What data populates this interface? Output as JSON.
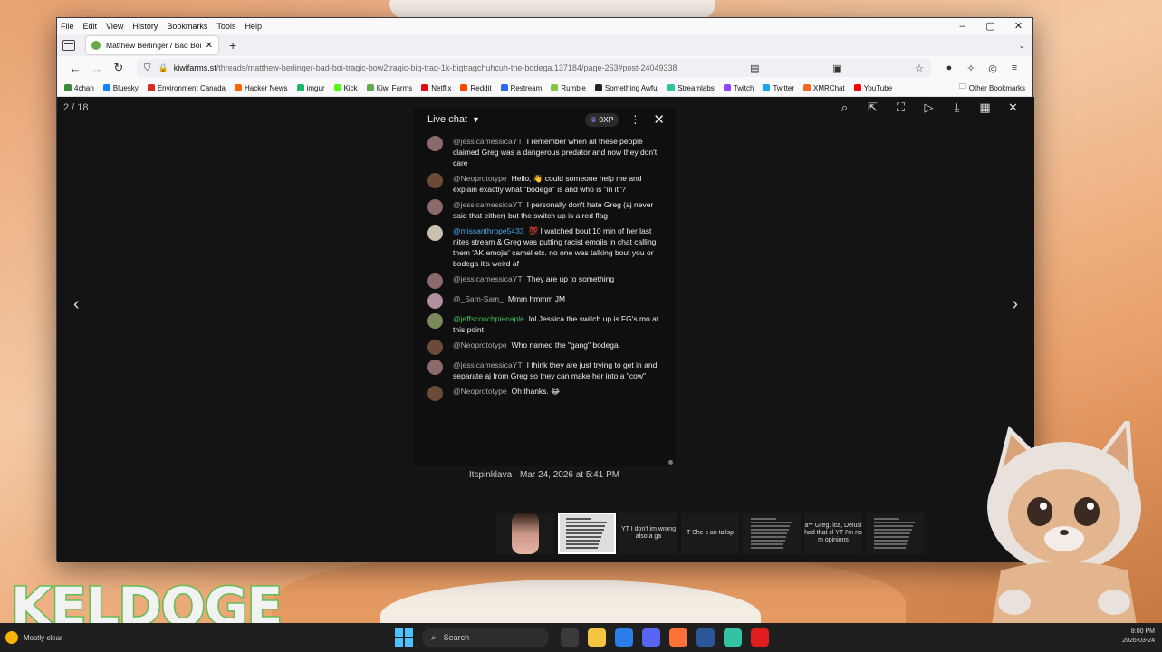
{
  "menubar": {
    "items": [
      "File",
      "Edit",
      "View",
      "History",
      "Bookmarks",
      "Tools",
      "Help"
    ]
  },
  "tab": {
    "title": "Matthew Berlinger / Bad Boi Tr"
  },
  "urlbar": {
    "domain": "kiwifarms.st",
    "path": "/threads/matthew-berlinger-bad-boi-tragic-bow2tragic-big-trag-1k-bigtragchuhcuh-the-bodega.137184/page-253#post-24049338"
  },
  "bookmarks": [
    {
      "label": "4chan",
      "color": "#3a8a3a"
    },
    {
      "label": "Bluesky",
      "color": "#1185fe"
    },
    {
      "label": "Environment Canada",
      "color": "#d52b1e"
    },
    {
      "label": "Hacker News",
      "color": "#ff6600"
    },
    {
      "label": "imgur",
      "color": "#1bb76e"
    },
    {
      "label": "Kick",
      "color": "#53fc18"
    },
    {
      "label": "Kiwi Farms",
      "color": "#66a84a"
    },
    {
      "label": "Netflix",
      "color": "#e50914"
    },
    {
      "label": "Reddit",
      "color": "#ff4500"
    },
    {
      "label": "Restream",
      "color": "#2b6bf3"
    },
    {
      "label": "Rumble",
      "color": "#85c742"
    },
    {
      "label": "Something Awful",
      "color": "#222222"
    },
    {
      "label": "Streamlabs",
      "color": "#31c3a2"
    },
    {
      "label": "Twitch",
      "color": "#9146ff"
    },
    {
      "label": "Twitter",
      "color": "#1da1f2"
    },
    {
      "label": "XMRChat",
      "color": "#f26822"
    },
    {
      "label": "YouTube",
      "color": "#ff0000"
    }
  ],
  "other_bookmarks": "Other Bookmarks",
  "viewer": {
    "counter": "2 / 18",
    "caption": "Itspinklava · Mar 24, 2026 at 5:41 PM"
  },
  "chat": {
    "title": "Live chat",
    "badge": "0XP",
    "messages": [
      {
        "author": "@jessicamessicaYT",
        "text": "I remember when all these people claimed Greg was a dangerous predator and now they don't care",
        "avatar": "#8a6a6a",
        "style": ""
      },
      {
        "author": "@Neoprototype",
        "text": "Hello, 👋 could someone help me and explain exactly what \"bodega\" is and who is \"in it\"?",
        "avatar": "#6b4a3a",
        "style": ""
      },
      {
        "author": "@jessicamessicaYT",
        "text": "I personally don't hate Greg (aj never said that either) but the switch up is a red flag",
        "avatar": "#8a6a6a",
        "style": ""
      },
      {
        "author": "@missanthrope5433",
        "text": "💯 I watched bout 10 min of her last nites stream & Greg was putting racist emojis in chat calling them 'AK emojis' camel etc. no one was talking bout you or bodega it's weird af",
        "avatar": "#c9c0b0",
        "style": "member"
      },
      {
        "author": "@jessicamessicaYT",
        "text": "They are up to something",
        "avatar": "#8a6a6a",
        "style": ""
      },
      {
        "author": "@_Sam-Sam_",
        "text": "Mmm hmmm JM",
        "avatar": "#b08fa0",
        "style": ""
      },
      {
        "author": "@jeffscouchpienaple",
        "text": "lol Jessica the switch up is FG's mo at this point",
        "avatar": "#7a8a5a",
        "style": "green"
      },
      {
        "author": "@Neoprototype",
        "text": "Who named the \"gang\" bodega.",
        "avatar": "#6b4a3a",
        "style": ""
      },
      {
        "author": "@jessicamessicaYT",
        "text": "I think they are just trying to get in and separate aj from Greg so they can make her into a \"cow\"",
        "avatar": "#8a6a6a",
        "style": ""
      },
      {
        "author": "@Neoprototype",
        "text": "Oh thanks. 😂",
        "avatar": "#6b4a3a",
        "style": ""
      }
    ]
  },
  "thumbs": [
    {
      "kind": "face",
      "text": ""
    },
    {
      "kind": "chat",
      "text": ""
    },
    {
      "kind": "text",
      "text": "YT I don't im wrong also a ga"
    },
    {
      "kind": "text",
      "text": "T She c an tailsp"
    },
    {
      "kind": "lines",
      "text": ""
    },
    {
      "kind": "text",
      "text": "a** Greg. ica, Delusi had that cl YT I'm no m opinions"
    },
    {
      "kind": "lines",
      "text": ""
    }
  ],
  "taskbar": {
    "weather": "Mostly clear",
    "search": "Search",
    "time": "8:00 PM",
    "date": "2026-03-24",
    "icons": [
      "#3a3a3a",
      "#f5c542",
      "#2b7de9",
      "#5865f2",
      "#ff7139",
      "#2b579a",
      "#31c3a2",
      "#e01e1e"
    ]
  },
  "overlay": {
    "streamer": "KELDOGE"
  },
  "colors": {
    "accent": "#4cc2ff",
    "brand_green": "#5fbf53",
    "member_name": "#4ea5e9"
  }
}
